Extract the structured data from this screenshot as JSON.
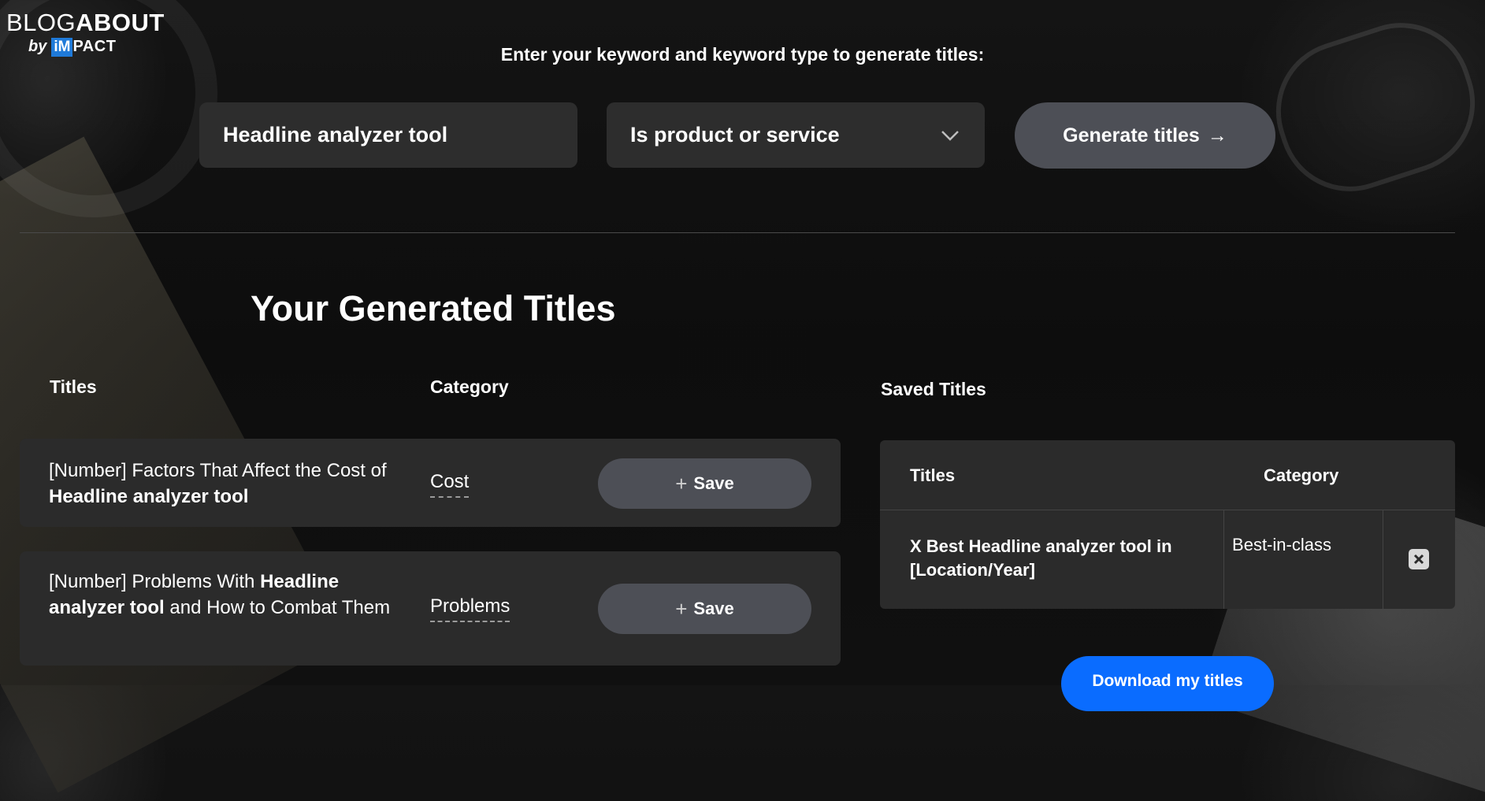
{
  "brand": {
    "blog": "BLOG",
    "about": "ABOUT",
    "by": "by",
    "im": "iM",
    "pact": "PACT"
  },
  "prompt": "Enter your keyword and keyword type to generate titles:",
  "keyword_input": {
    "value": "Headline analyzer tool"
  },
  "keyword_type": {
    "selected": "Is product or service"
  },
  "generate_button": {
    "label": "Generate titles",
    "arrow": "→"
  },
  "section_title": "Your Generated Titles",
  "generated": {
    "headers": {
      "titles": "Titles",
      "category": "Category"
    },
    "rows": [
      {
        "before": "[Number] Factors That Affect the Cost of ",
        "keyword": "Headline analyzer tool",
        "after": "",
        "category": "Cost",
        "save": "Save"
      },
      {
        "before": "[Number] Problems With ",
        "keyword": "Headline analyzer tool",
        "after": " and How to Combat Them",
        "category": "Problems",
        "save": "Save"
      }
    ]
  },
  "saved": {
    "heading": "Saved Titles",
    "headers": {
      "titles": "Titles",
      "category": "Category"
    },
    "rows": [
      {
        "before": "X Best ",
        "keyword": "Headline analyzer tool",
        "after": " in [Location/Year]",
        "category": "Best-in-class"
      }
    ]
  },
  "download_button": {
    "label": "Download my titles"
  },
  "colors": {
    "accent": "#0a6cff",
    "button_gray": "#4d4f56",
    "panel": "#2b2b2b"
  }
}
